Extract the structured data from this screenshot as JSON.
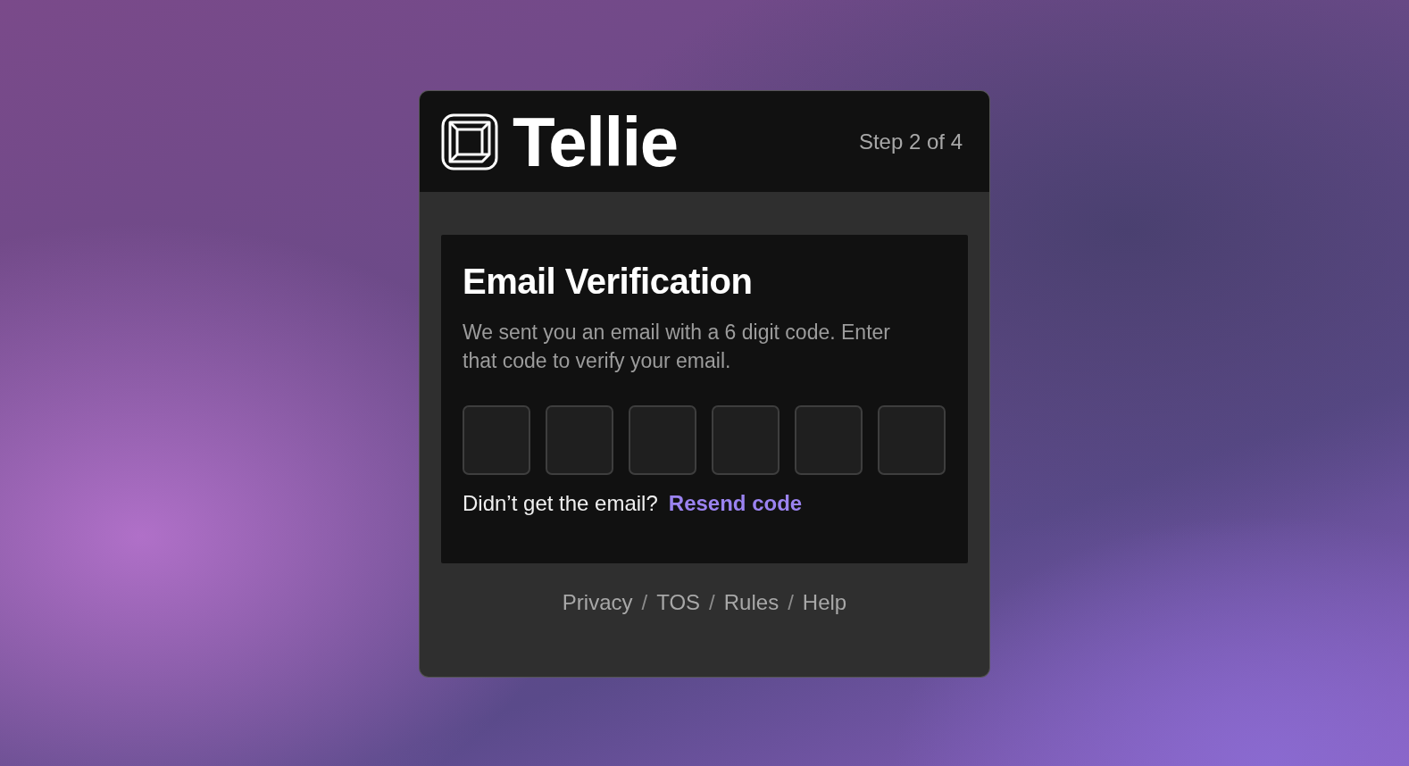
{
  "header": {
    "brand": "Tellie",
    "step": "Step 2 of 4"
  },
  "verification": {
    "title": "Email Verification",
    "description": "We sent you an email with a 6 digit code. Enter that code to verify your email.",
    "code_fields": [
      {
        "kind": "digit"
      },
      {
        "kind": "digit"
      },
      {
        "kind": "digit"
      },
      {
        "kind": "digit"
      },
      {
        "kind": "digit"
      },
      {
        "kind": "digit"
      }
    ],
    "resend_prompt": "Didn’t get the email?",
    "resend_link": "Resend code"
  },
  "footer": [
    {
      "kind": "link",
      "text": "Privacy"
    },
    {
      "kind": "separator",
      "text": "/"
    },
    {
      "kind": "link",
      "text": "TOS"
    },
    {
      "kind": "separator",
      "text": "/"
    },
    {
      "kind": "link",
      "text": "Rules"
    },
    {
      "kind": "separator",
      "text": "/"
    },
    {
      "kind": "link",
      "text": "Help"
    }
  ]
}
